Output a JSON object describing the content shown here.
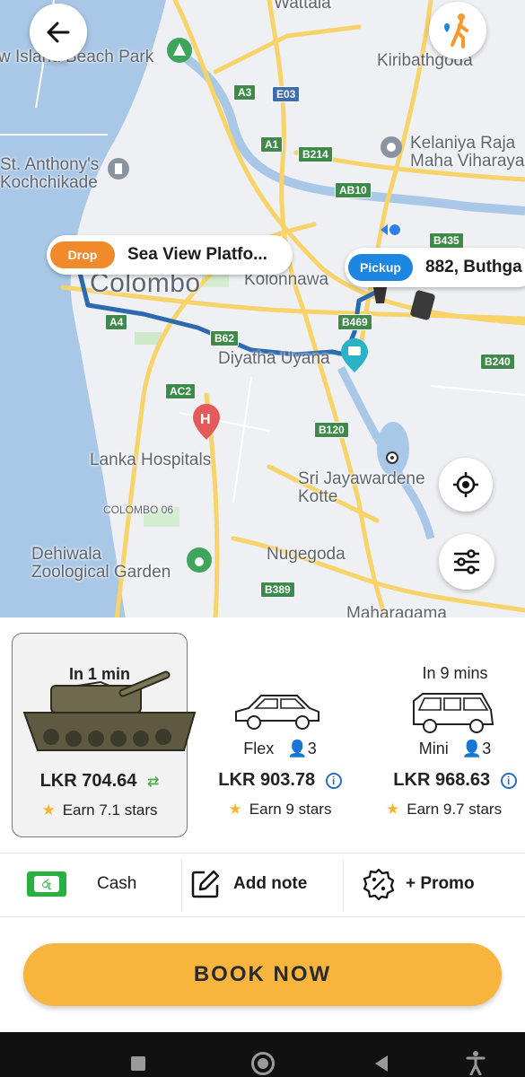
{
  "map": {
    "labels": {
      "beach_park": "w Island Beach Park",
      "kiribathgoda": "Kiribathgoda",
      "kelaniya": "Kelaniya Raja\nMaha Viharaya",
      "st_anthonys": "St. Anthony's\nKochchikade",
      "colombo": "Colombo",
      "kolonnawa": "Kolonnawa",
      "diyatha": "Diyatha Uyana",
      "lanka_hospitals": "Lanka Hospitals",
      "sri_jaya": "Sri Jayawardene\nKotte",
      "colombo06": "COLOMBO 06",
      "dehiwala": "Dehiwala\nZoological Garden",
      "nugegoda": "Nugegoda",
      "maharagama": "Maharagama",
      "wattala": "Wattala"
    },
    "roads": {
      "a3": "A3",
      "e03": "E03",
      "a1": "A1",
      "b214": "B214",
      "ab10": "AB10",
      "b435": "B435",
      "a4": "A4",
      "b62": "B62",
      "b469": "B469",
      "b240": "B240",
      "ac2": "AC2",
      "b120": "B120",
      "b389": "B389"
    },
    "drop": {
      "tag": "Drop",
      "text": "Sea View Platfo..."
    },
    "pickup": {
      "tag": "Pickup",
      "text": "882, Buthga"
    }
  },
  "rides": [
    {
      "eta": "In 1 min",
      "price": "LKR 704.64",
      "stars": "Earn 7.1 stars",
      "icon": "tank-icon",
      "selected": true
    },
    {
      "name": "Flex",
      "seats": "3",
      "price": "LKR 903.78",
      "stars": "Earn 9 stars",
      "icon": "car-icon"
    },
    {
      "eta": "In 9 mins",
      "name": "Mini",
      "seats": "3",
      "price": "LKR 968.63",
      "stars": "Earn 9.7 stars",
      "icon": "van-icon"
    }
  ],
  "options": {
    "payment": "Cash",
    "note": "Add note",
    "promo": "+ Promo"
  },
  "book_label": "BOOK NOW",
  "colors": {
    "accent": "#f8b53e",
    "drop": "#f08a2a",
    "pickup": "#1d86e0",
    "route": "#2c6ab0"
  }
}
